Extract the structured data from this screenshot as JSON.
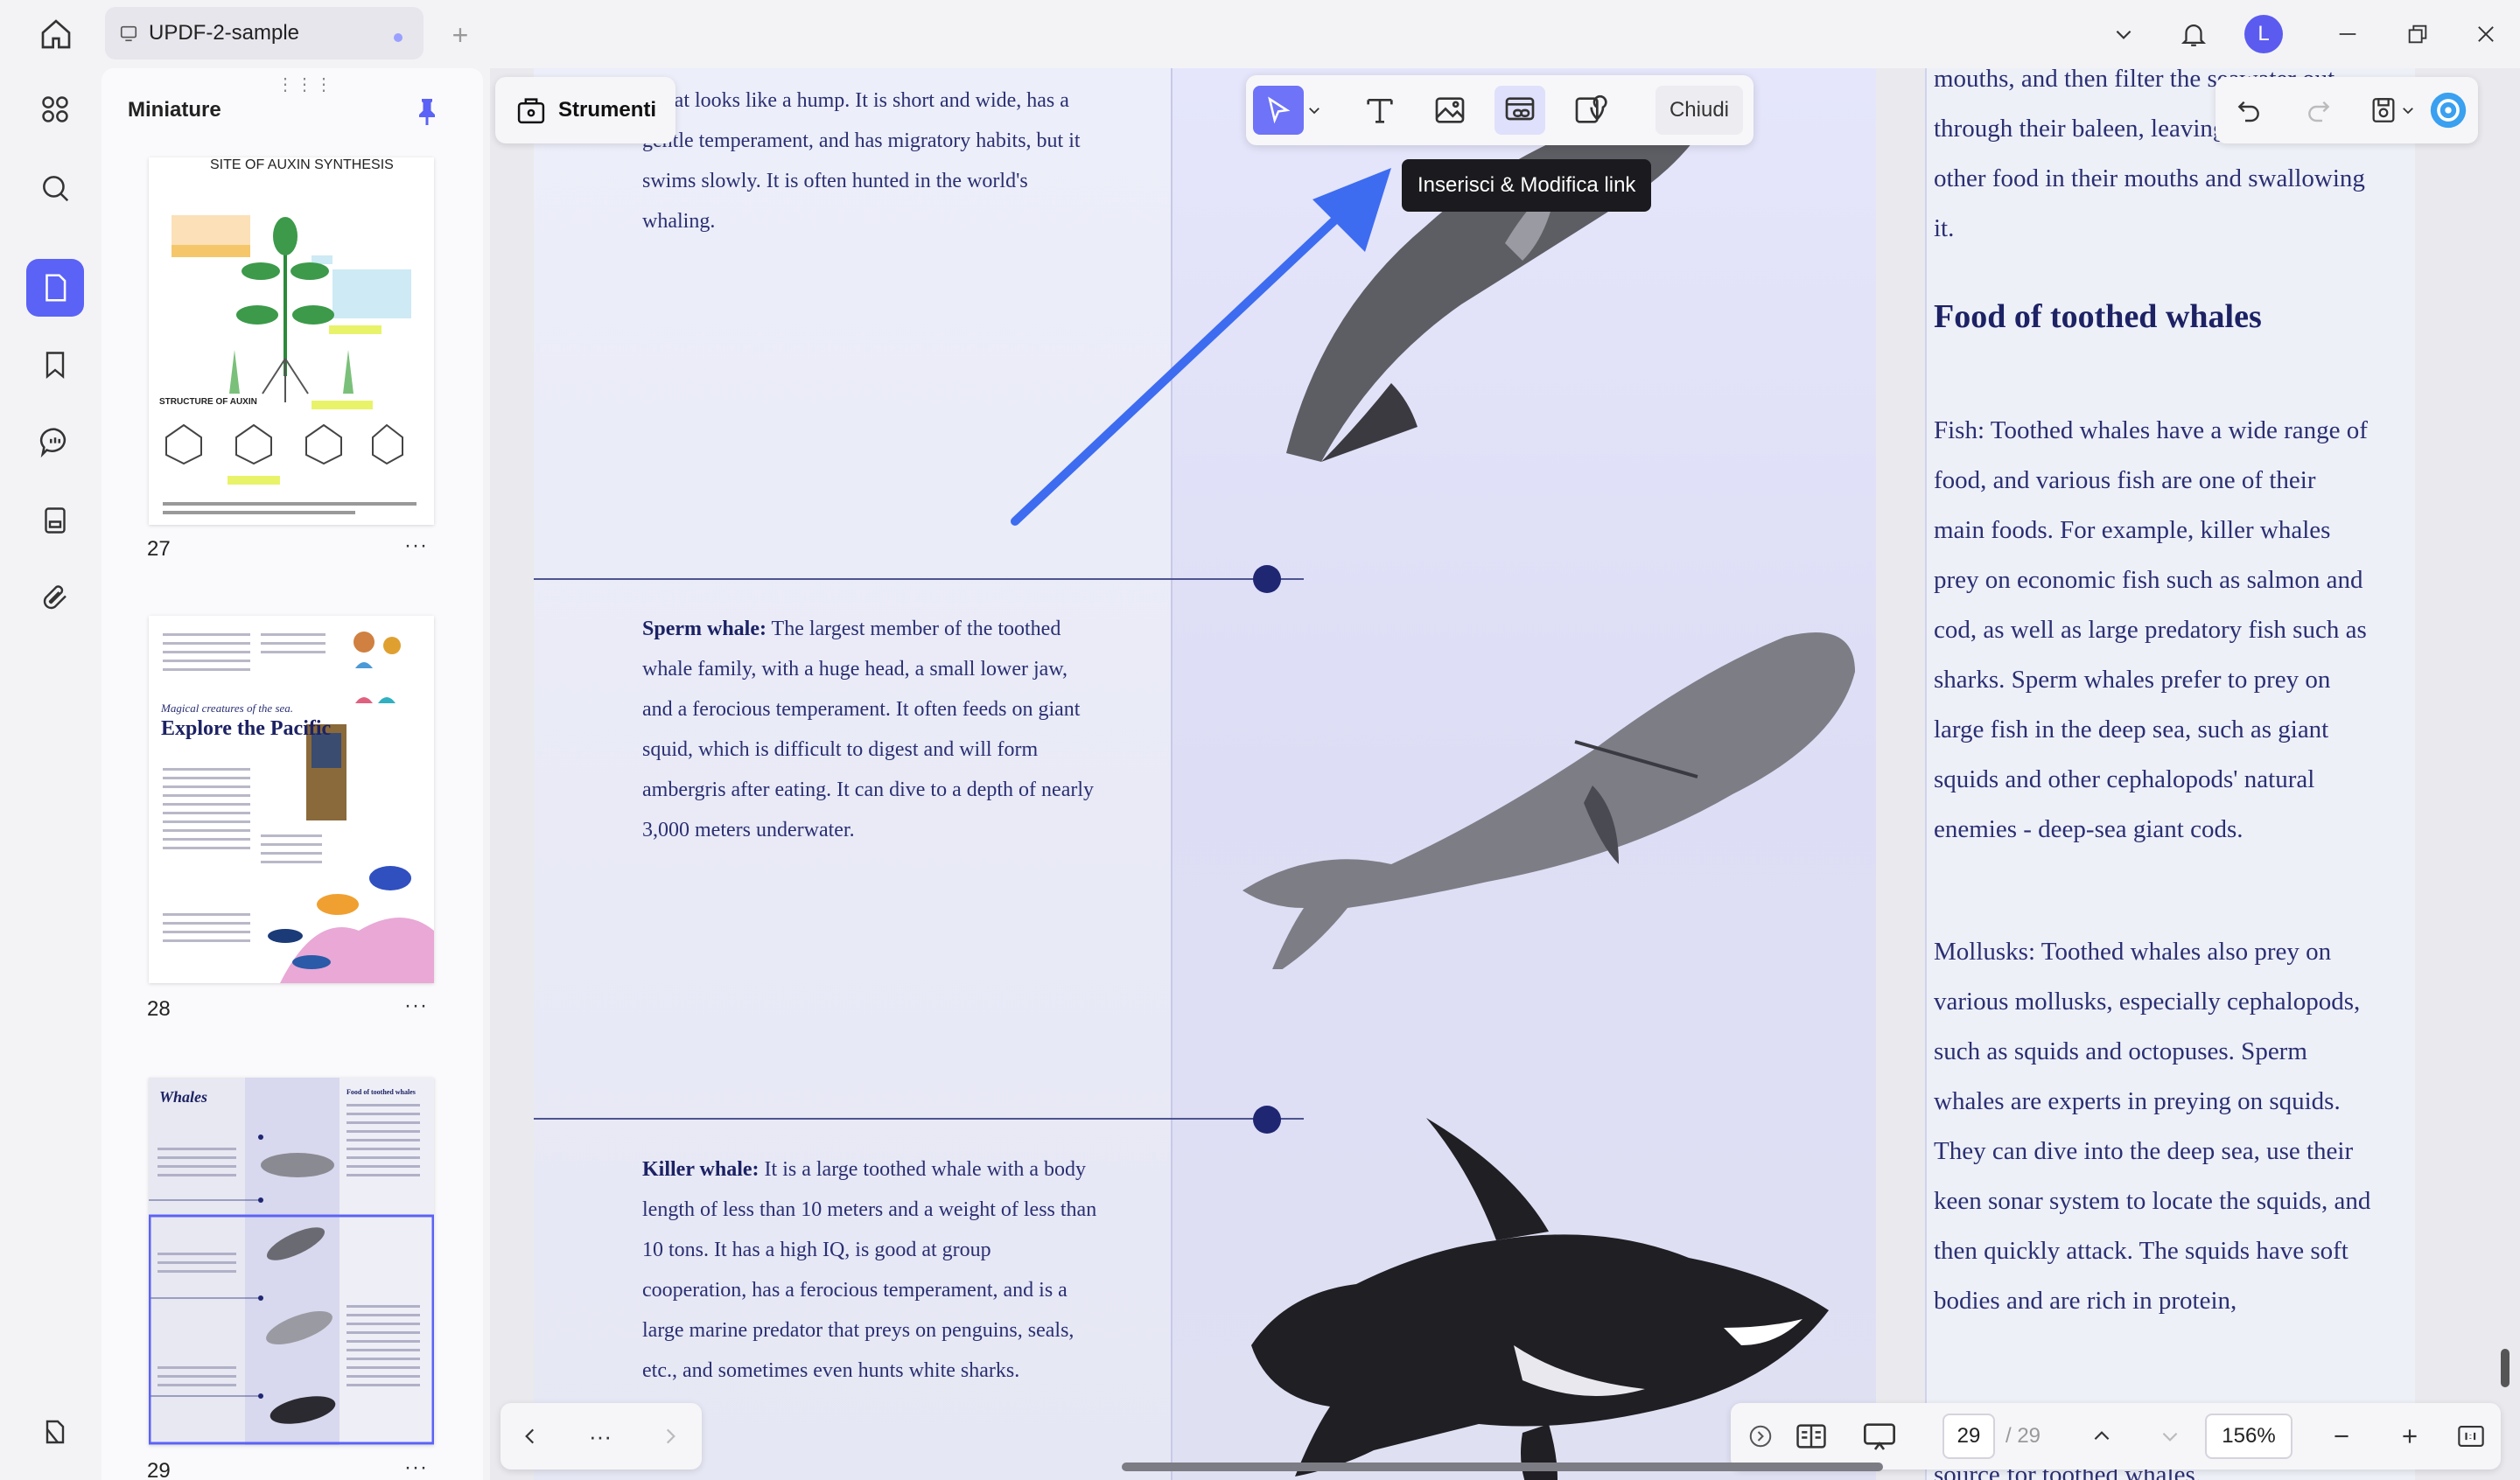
{
  "titlebar": {
    "tab_title": "UPDF-2-sample",
    "new_tab": "+",
    "avatar_initial": "L"
  },
  "thumbnails": {
    "title": "Miniature",
    "pages": [
      {
        "label": "27",
        "heading": "SITE OF AUXIN SYNTHESIS",
        "sub": "STRUCTURE OF AUXIN"
      },
      {
        "label": "28",
        "heading": "Explore the Pacific",
        "sub": "Magical creatures of the sea."
      },
      {
        "label": "29",
        "heading": "Whales",
        "sub": "Food of toothed whales"
      }
    ],
    "more": "···"
  },
  "toolbar": {
    "tools_label": "Strumenti",
    "close_label": "Chiudi",
    "tooltip": "Inserisci & Modifica link"
  },
  "document": {
    "left_top": "k that looks like a hump. It is short and wide, has a gentle temperament, and has migratory habits, but it swims slowly. It is often hunted in the world's whaling.",
    "sperm_title": "Sperm whale:",
    "sperm_text": " The largest member of the toothed whale family, with a huge head, a small lower jaw, and a ferocious temperament. It often feeds on giant squid, which is difficult to digest and will form ambergris after eating. It can dive to a depth of nearly 3,000 meters underwater.",
    "killer_title": "Killer whale:",
    "killer_text": " It is a large toothed whale with a body length of less than 10 meters and a weight of less than 10 tons. It has a high IQ, is good at group cooperation, has a ferocious temperament, and is a large marine predator that preys on penguins, seals, etc., and sometimes even hunts white sharks.",
    "right_top": "mouths, and then filter the seawater out through their baleen, leaving fish and other food in their mouths and swallowing it.",
    "right_heading": "Food of toothed whales",
    "right_fish": "Fish: Toothed whales have a wide range of food, and various fish are one of their main foods. For example, killer whales prey on economic fish such as salmon and cod, as well as large predatory fish such as sharks. Sperm whales prefer to prey on large fish in the deep sea, such as giant squids and other cephalopods' natural enemies - deep-sea giant cods.",
    "right_mollusks": "Mollusks: Toothed whales also prey on various mollusks, especially cephalopods, such as squids and octopuses. Sperm whales are experts in preying on squids. They can dive into the deep sea, use their keen sonar system to locate the squids, and then quickly attack. The squids have soft bodies and are rich in protein,",
    "right_bottom": "source for toothed whales."
  },
  "navigation": {
    "current_page": "29",
    "total_pages": "/ 29",
    "zoom": "156%",
    "more": "···"
  }
}
